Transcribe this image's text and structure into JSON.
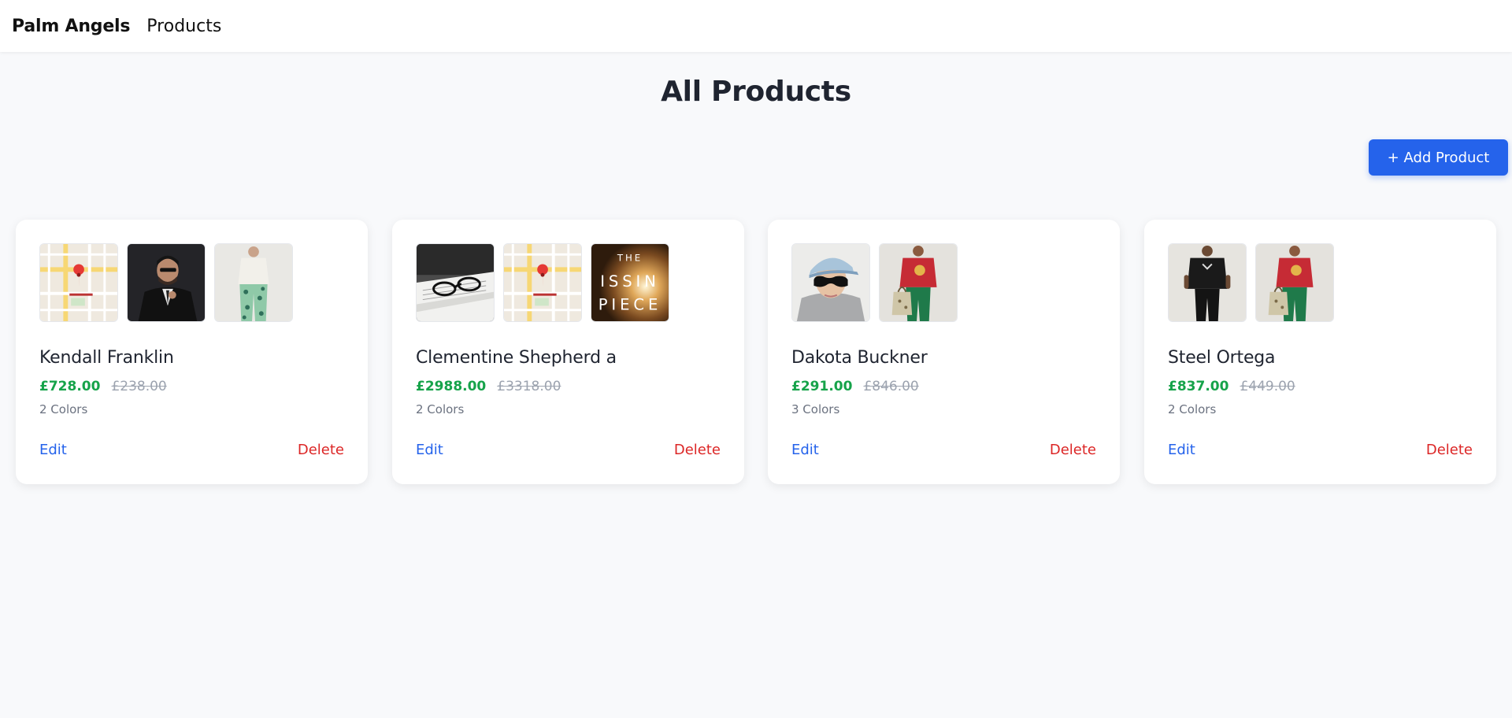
{
  "nav": {
    "brand": "Palm Angels",
    "products_link": "Products"
  },
  "page": {
    "title": "All Products",
    "add_button": "+ Add Product"
  },
  "colors": {
    "accent": "#2563eb",
    "price": "#16a34a",
    "delete": "#dc2626",
    "muted": "#9ca3af"
  },
  "products": [
    {
      "name": "Kendall Franklin",
      "price": "£728.00",
      "old_price": "£238.00",
      "colors": "2 Colors",
      "edit": "Edit",
      "delete": "Delete",
      "images": [
        "map-image",
        "man-in-suit-image",
        "person-patterned-pants-image"
      ]
    },
    {
      "name": "Clementine Shepherd a",
      "price": "£2988.00",
      "old_price": "£3318.00",
      "colors": "2 Colors",
      "edit": "Edit",
      "delete": "Delete",
      "images": [
        "glasses-on-book-image",
        "map-image",
        "the-missing-piece-poster-image"
      ],
      "poster_text": [
        "THE",
        "ISSIN",
        "PIECE"
      ]
    },
    {
      "name": "Dakota Buckner",
      "price": "£291.00",
      "old_price": "£846.00",
      "colors": "3 Colors",
      "edit": "Edit",
      "delete": "Delete",
      "images": [
        "model-with-cap-sunglasses-image",
        "model-red-tshirt-tote-image"
      ]
    },
    {
      "name": "Steel Ortega",
      "price": "£837.00",
      "old_price": "£449.00",
      "colors": "2 Colors",
      "edit": "Edit",
      "delete": "Delete",
      "images": [
        "model-black-outfit-image",
        "model-red-tshirt-tote-image"
      ]
    }
  ]
}
